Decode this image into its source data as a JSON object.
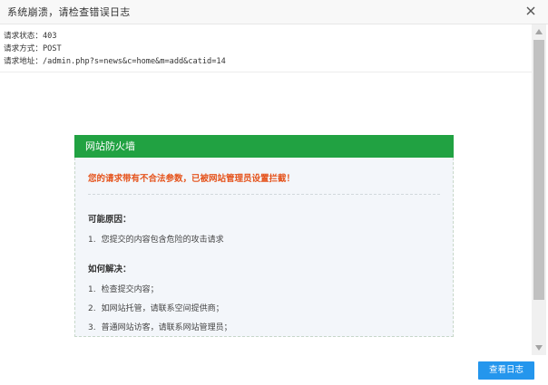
{
  "dialog": {
    "title": "系统崩溃，请检查错误日志",
    "close_icon": "close-icon"
  },
  "request": {
    "status": "请求状态：403",
    "method": "请求方式：POST",
    "url": "请求地址：/admin.php?s=news&c=home&m=add&catid=14"
  },
  "firewall": {
    "header": "网站防火墙",
    "warning": "您的请求带有不合法参数，已被网站管理员设置拦截！",
    "reason_title": "可能原因：",
    "reasons": [
      {
        "num": "1.",
        "text": "您提交的内容包含危险的攻击请求"
      }
    ],
    "solution_title": "如何解决：",
    "solutions": [
      {
        "num": "1.",
        "text": "检查提交内容；"
      },
      {
        "num": "2.",
        "text": "如网站托管，请联系空间提供商；"
      },
      {
        "num": "3.",
        "text": "普通网站访客，请联系网站管理员；"
      }
    ],
    "accent_color": "#21a242",
    "warning_color": "#e5541d"
  },
  "footer": {
    "view_log_label": "查看日志",
    "button_color": "#2496ed"
  }
}
